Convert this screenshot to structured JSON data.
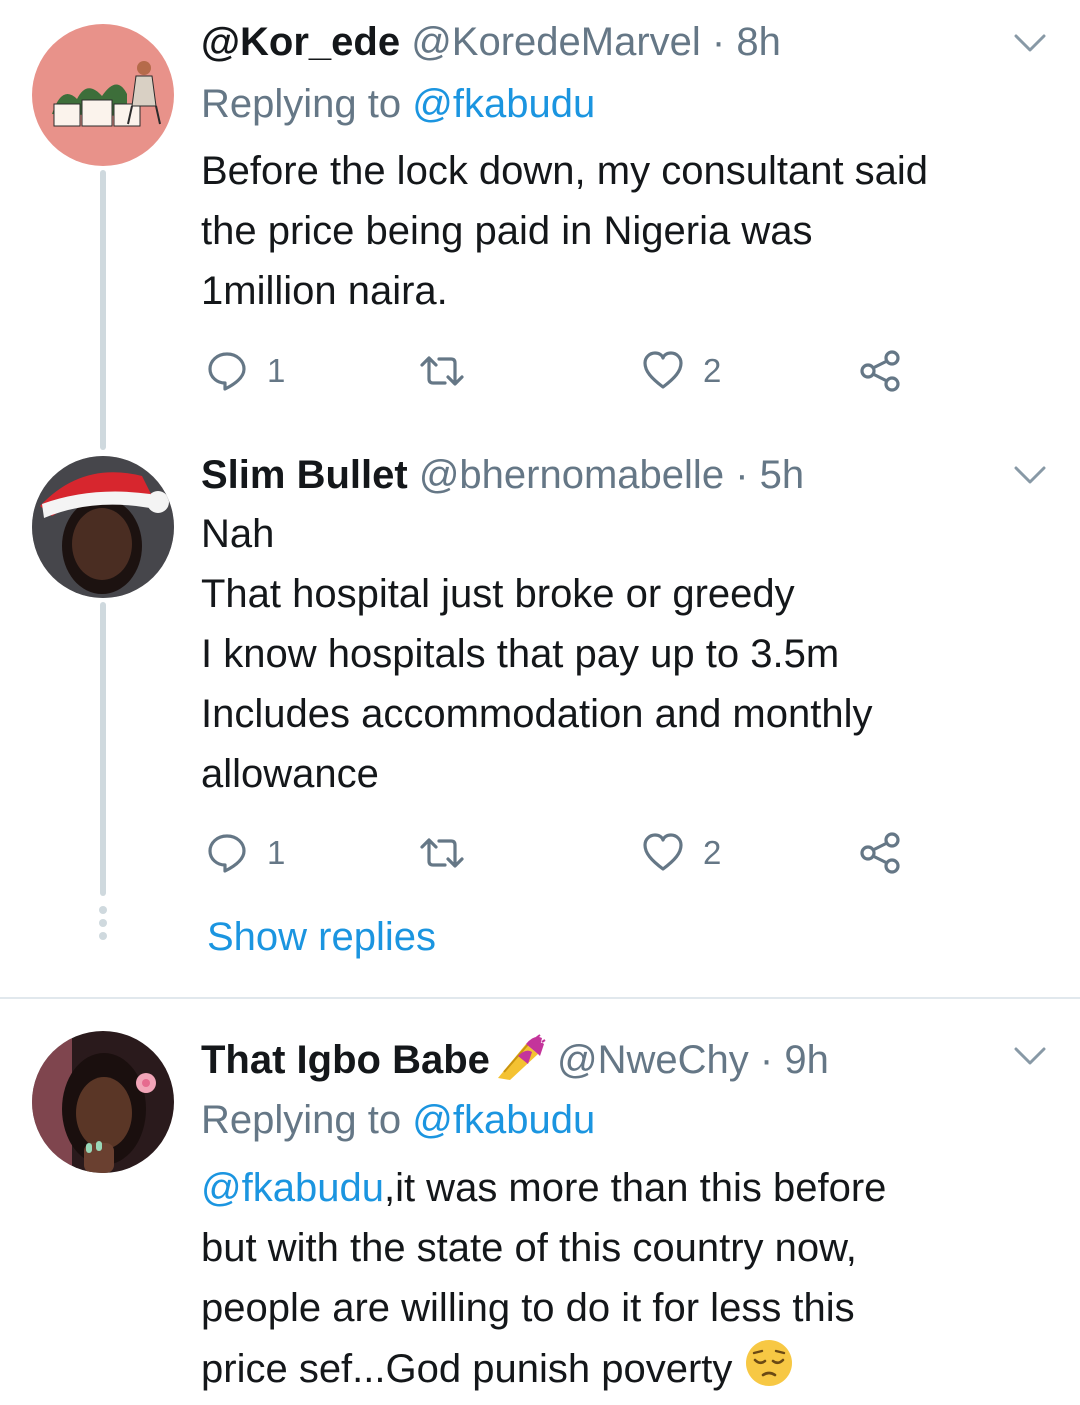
{
  "tweets": [
    {
      "display_name": "@Kor_ede",
      "handle": "@KoredeMarvel",
      "separator": "·",
      "time": "8h",
      "replying_prefix": "Replying to",
      "replying_to": "@fkabudu",
      "lines": [
        "Before the lock down, my consultant said",
        "the price being paid in Nigeria was",
        "1million naira."
      ],
      "reply_count": "1",
      "like_count": "2"
    },
    {
      "display_name": "Slim Bullet",
      "handle": "@bhernomabelle",
      "separator": "·",
      "time": "5h",
      "lines": [
        "Nah",
        "That hospital just broke or greedy",
        "I know hospitals that pay up to 3.5m",
        "Includes accommodation and monthly",
        "allowance"
      ],
      "reply_count": "1",
      "like_count": "2",
      "show_replies": "Show replies"
    },
    {
      "display_name": "That Igbo Babe",
      "name_emoji": "nail-polish-emoji",
      "handle": "@NweChy",
      "separator": "·",
      "time": "9h",
      "replying_prefix": "Replying to",
      "replying_to": "@fkabudu",
      "mention": "@fkabudu",
      "line1_rest": ",it was more than this before",
      "lines": [
        "but with the state of this country now,",
        "people are willing to do it for less this",
        "price sef...God punish poverty"
      ],
      "end_emoji": "pensive-face-emoji"
    }
  ],
  "colors": {
    "link": "#1b95e0",
    "muted": "#657786",
    "text": "#14171a",
    "thread_line": "#cfd9de",
    "divider": "#e1e8ed"
  },
  "icons": [
    "reply-icon",
    "retweet-icon",
    "like-icon",
    "share-icon",
    "chevron-down-icon"
  ]
}
